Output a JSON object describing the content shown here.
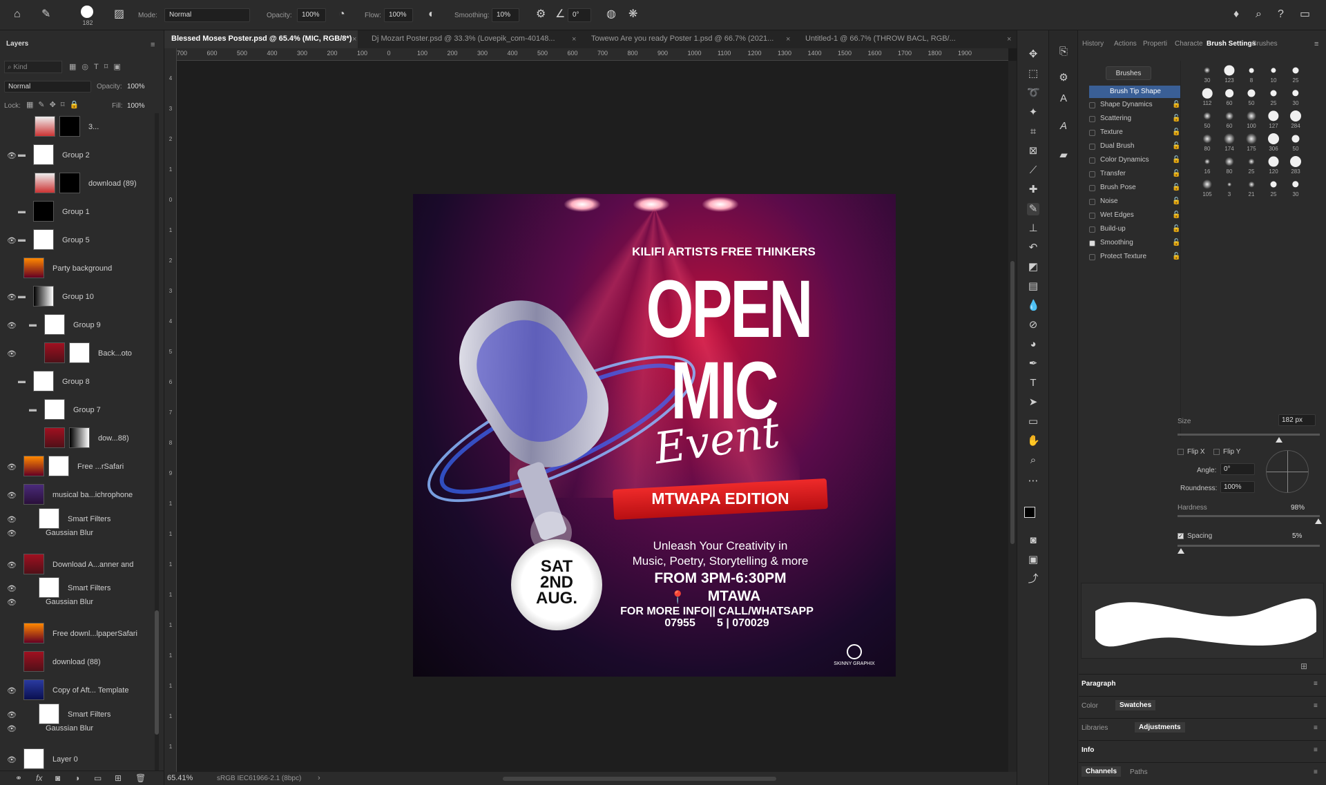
{
  "options_bar": {
    "brush_size": "182",
    "mode_label": "Mode:",
    "mode_value": "Normal",
    "opacity_label": "Opacity:",
    "opacity_value": "100%",
    "flow_label": "Flow:",
    "flow_value": "100%",
    "smoothing_label": "Smoothing:",
    "smoothing_value": "10%",
    "angle_value": "0°"
  },
  "tabs": [
    {
      "label": "Blessed Moses Poster.psd @ 65.4% (MIC, RGB/8*)",
      "active": true
    },
    {
      "label": "Dj Mozart Poster.psd @ 33.3% (Lovepik_com-40148...",
      "active": false
    },
    {
      "label": "Towewo Are you ready Poster 1.psd @ 66.7% (2021...",
      "active": false
    },
    {
      "label": "Untitled-1 @ 66.7% (THROW BACL, RGB/...",
      "active": false
    }
  ],
  "ruler_h": [
    "700",
    "600",
    "500",
    "400",
    "300",
    "200",
    "100",
    "0",
    "100",
    "200",
    "300",
    "400",
    "500",
    "600",
    "700",
    "800",
    "900",
    "1000",
    "1100",
    "1200",
    "1300",
    "1400",
    "1500",
    "1600",
    "1700",
    "1800",
    "1900"
  ],
  "ruler_v": [
    "4",
    "3",
    "2",
    "1",
    "0",
    "1",
    "2",
    "3",
    "4",
    "5",
    "6",
    "7",
    "8",
    "9",
    "1",
    "1",
    "1",
    "1",
    "1",
    "1",
    "1",
    "1",
    "1"
  ],
  "layers_panel": {
    "title": "Layers",
    "kind_placeholder": "Kind",
    "blend_mode": "Normal",
    "opacity_label": "Opacity:",
    "opacity_value": "100%",
    "lock_label": "Lock:",
    "fill_label": "Fill:",
    "fill_value": "100%",
    "layers": [
      {
        "name": "3...",
        "visible": false
      },
      {
        "name": "Group 2",
        "visible": true
      },
      {
        "name": "download (89)",
        "visible": false
      },
      {
        "name": "Group 1",
        "visible": false
      },
      {
        "name": "Group 5",
        "visible": true
      },
      {
        "name": "Party background",
        "visible": false
      },
      {
        "name": "Group 10",
        "visible": true
      },
      {
        "name": "Group 9",
        "visible": true
      },
      {
        "name": "Back...oto",
        "visible": true
      },
      {
        "name": "Group 8",
        "visible": false
      },
      {
        "name": "Group 7",
        "visible": false
      },
      {
        "name": "dow...88)",
        "visible": false
      },
      {
        "name": "Free ...rSafari",
        "visible": true
      },
      {
        "name": "musical ba...ichrophone",
        "visible": true
      },
      {
        "name": "Smart Filters",
        "visible": true
      },
      {
        "name": "Gaussian Blur",
        "visible": true
      },
      {
        "name": "Download A...anner and",
        "visible": true
      },
      {
        "name": "Smart Filters",
        "visible": true
      },
      {
        "name": "Gaussian Blur",
        "visible": true
      },
      {
        "name": "Free downl...lpaperSafari",
        "visible": false
      },
      {
        "name": "download (88)",
        "visible": false
      },
      {
        "name": "Copy of Aft... Template",
        "visible": true
      },
      {
        "name": "Smart Filters",
        "visible": true
      },
      {
        "name": "Gaussian Blur",
        "visible": true
      },
      {
        "name": "Layer 0",
        "visible": true
      }
    ]
  },
  "status_bar": {
    "zoom": "65.41%",
    "profile": "sRGB IEC61966-2.1 (8bpc)"
  },
  "right_panel": {
    "tabs": [
      "History",
      "Actions",
      "Properti",
      "Characte",
      "Brush Settings",
      "Brushes"
    ],
    "active_tab": "Brush Settings",
    "brushes_button": "Brushes",
    "brush_tip_shape": "Brush Tip Shape",
    "options": [
      {
        "label": "Shape Dynamics",
        "checked": false
      },
      {
        "label": "Scattering",
        "checked": false
      },
      {
        "label": "Texture",
        "checked": false
      },
      {
        "label": "Dual Brush",
        "checked": false
      },
      {
        "label": "Color Dynamics",
        "checked": false
      },
      {
        "label": "Transfer",
        "checked": false
      },
      {
        "label": "Brush Pose",
        "checked": false
      },
      {
        "label": "Noise",
        "checked": false
      },
      {
        "label": "Wet Edges",
        "checked": false
      },
      {
        "label": "Build-up",
        "checked": false
      },
      {
        "label": "Smoothing",
        "checked": true
      },
      {
        "label": "Protect Texture",
        "checked": false
      }
    ],
    "presets": [
      "30",
      "123",
      "8",
      "10",
      "25",
      "112",
      "60",
      "50",
      "25",
      "30",
      "50",
      "60",
      "100",
      "127",
      "284",
      "80",
      "174",
      "175",
      "306",
      "50",
      "16",
      "80",
      "25",
      "120",
      "283",
      "105",
      "3",
      "21",
      "25",
      "30"
    ],
    "size_label": "Size",
    "size_value": "182 px",
    "flip_x": "Flip X",
    "flip_y": "Flip Y",
    "angle_label": "Angle:",
    "angle_value": "0°",
    "roundness_label": "Roundness:",
    "roundness_value": "100%",
    "hardness_label": "Hardness",
    "hardness_value": "98%",
    "spacing_label": "Spacing",
    "spacing_value": "5%",
    "panels": [
      {
        "tabs": [
          "Paragraph"
        ],
        "active": "Paragraph"
      },
      {
        "tabs": [
          "Color",
          "Swatches"
        ],
        "active": "Swatches"
      },
      {
        "tabs": [
          "Libraries",
          "Adjustments"
        ],
        "active": "Adjustments"
      },
      {
        "tabs": [
          "Info"
        ],
        "active": "Info"
      },
      {
        "tabs": [
          "Channels",
          "Paths"
        ],
        "active": "Channels"
      }
    ]
  },
  "poster": {
    "org": "KILIFI ARTISTS FREE THINKERS",
    "line1": "OPEN",
    "line2": "MIC",
    "script": "Event",
    "banner": "MTWAPA EDITION",
    "date_day": "SAT",
    "date_num": "2ND",
    "date_month": "AUG.",
    "tagline1": "Unleash Your Creativity in",
    "tagline2": "Music, Poetry, Storytelling & more",
    "time": "FROM 3PM-6:30PM",
    "venue": "MTAWA",
    "contact1": "FOR MORE INFO|| CALL/WHATSAPP",
    "contact2": "07955       5 | 070029",
    "brand": "SKINNY GRAPHIX"
  }
}
